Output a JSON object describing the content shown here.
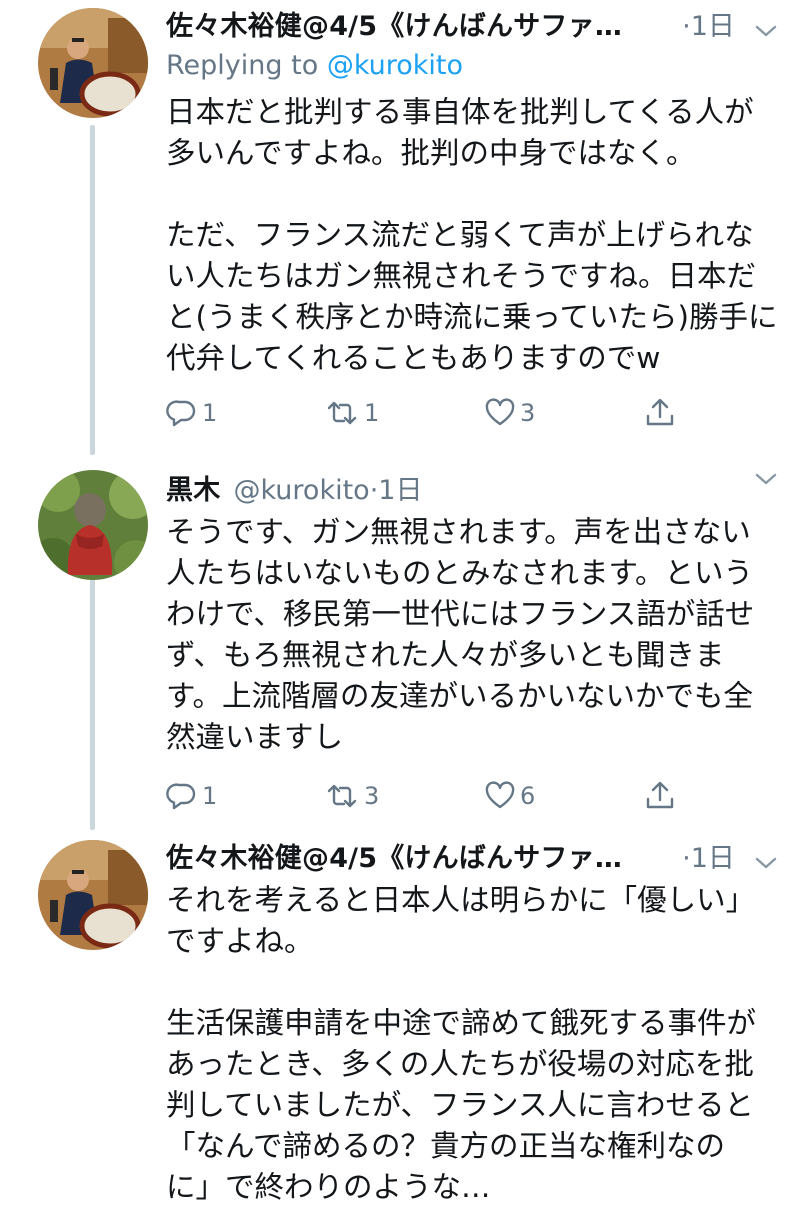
{
  "tweets": [
    {
      "name": "佐々木裕健@4/5《けんばんサファ…",
      "handle": "",
      "sep": "·",
      "time": "1日",
      "replying_prefix": "Replying to ",
      "replying_mention": "@kurokito",
      "body": "日本だと批判する事自体を批判してくる人が\n多いんですよね。批判の中身ではなく。\n\nただ、フランス流だと弱くて声が上げられな\nい人たちはガン無視されそうですね。日本だ\nと(うまく秩序とか時流に乗っていたら)勝手に\n代弁してくれることもありますのでw",
      "replies": "1",
      "retweets": "1",
      "likes": "3"
    },
    {
      "name": "黒木",
      "handle": "@kurokito",
      "sep": "·",
      "time": "1日",
      "body": "そうです、ガン無視されます。声を出さない\n人たちはいないものとみなされます。という\nわけで、移民第一世代にはフランス語が話せ\nず、もろ無視された人々が多いとも聞きま\nす。上流階層の友達がいるかいないかでも全\n然違いますし",
      "replies": "1",
      "retweets": "3",
      "likes": "6"
    },
    {
      "name": "佐々木裕健@4/5《けんばんサファ…",
      "handle": "",
      "sep": "·",
      "time": "1日",
      "body": "それを考えると日本人は明らかに「優しい」\nですよね。\n\n生活保護申請を中途で諦めて餓死する事件が\nあったとき、多くの人たちが役場の対応を批\n判していましたが、フランス人に言わせると\n「なんで諦めるの？貴方の正当な権利なの\nに」で終わりのような…"
    }
  ],
  "icons": {
    "reply": "reply-icon",
    "retweet": "retweet-icon",
    "like": "heart-icon",
    "share": "share-icon",
    "menu": "chevron-down-icon"
  },
  "colors": {
    "secondary_text": "#657786",
    "link": "#1da1f2",
    "thread_line": "#ccd6dd"
  }
}
